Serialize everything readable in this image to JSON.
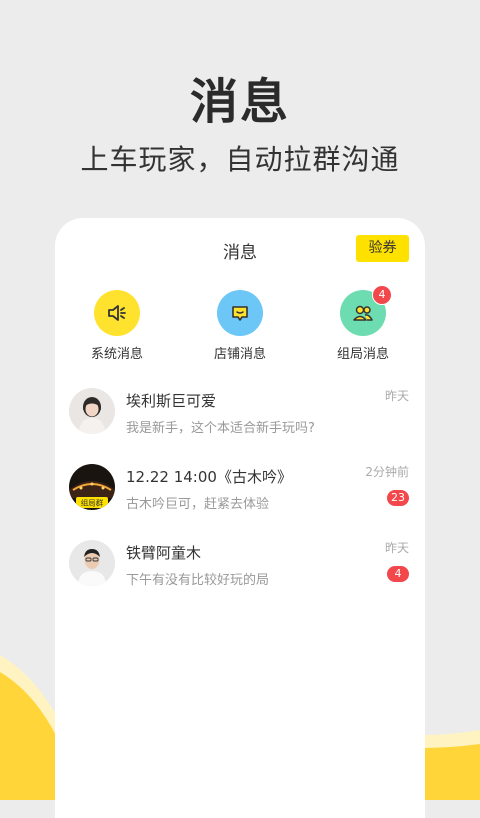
{
  "promo": {
    "title": "消息",
    "subtitle": "上车玩家，自动拉群沟通"
  },
  "header": {
    "title": "消息",
    "coupon_label": "验券"
  },
  "categories": [
    {
      "label": "系统消息",
      "icon": "speaker-icon",
      "color": "#ffe22e"
    },
    {
      "label": "店铺消息",
      "icon": "chat-bubble-icon",
      "color": "#6cc7f7"
    },
    {
      "label": "组局消息",
      "icon": "group-icon",
      "color": "#6ddcb1",
      "badge": "4"
    }
  ],
  "messages": [
    {
      "name": "埃利斯巨可爱",
      "preview": "我是新手，这个本适合新手玩吗?",
      "time": "昨天"
    },
    {
      "name": "12.22  14:00《古木吟》",
      "preview": "古木吟巨可，赶紧去体验",
      "time": "2分钟前",
      "badge": "23",
      "avatar_tag": "组局群"
    },
    {
      "name": "铁臂阿童木",
      "preview": "下午有没有比较好玩的局",
      "time": "昨天",
      "badge": "4"
    }
  ],
  "colors": {
    "accent_yellow": "#ffe100",
    "badge_red": "#f2474b",
    "background": "#ececec"
  }
}
